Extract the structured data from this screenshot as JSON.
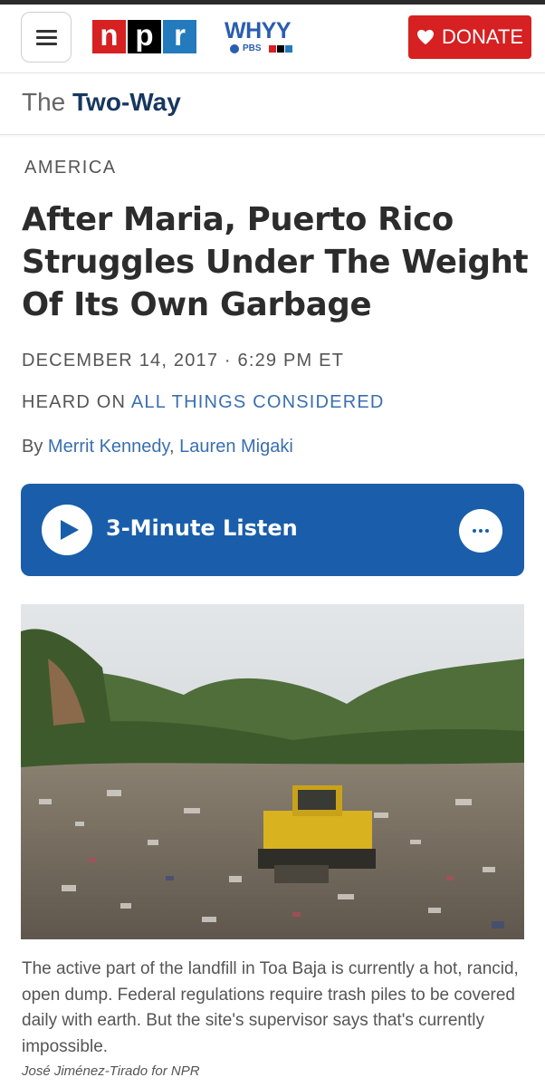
{
  "header": {
    "npr_logo": {
      "n": "n",
      "p": "p",
      "r": "r"
    },
    "station": {
      "name": "WHYY",
      "pbs": "PBS",
      "mini": "npr"
    },
    "donate_label": "DONATE"
  },
  "blog": {
    "prefix": "The",
    "name": "Two-Way"
  },
  "article": {
    "slug": "AMERICA",
    "headline": "After Maria, Puerto Rico Struggles Under The Weight Of Its Own Garbage",
    "dateline": "DECEMBER 14, 2017 · 6:29 PM ET",
    "heard_on_prefix": "HEARD ON",
    "heard_on_program": "ALL THINGS CONSIDERED",
    "by_prefix": "By",
    "author_1": "Merrit Kennedy",
    "author_sep": ", ",
    "author_2": "Lauren Migaki"
  },
  "player": {
    "label": "3-Minute Listen"
  },
  "image": {
    "caption": "The active part of the landfill in Toa Baja is currently a hot, rancid, open dump. Federal regulations require trash piles to be covered daily with earth. But the site's supervisor says that's currently impossible.",
    "credit": "José Jiménez-Tirado for NPR"
  },
  "colors": {
    "npr_red": "#d62021",
    "npr_blue": "#237bbd",
    "player_blue": "#1a5eab",
    "link_blue": "#3a6fb0",
    "blog_navy": "#17375e"
  }
}
